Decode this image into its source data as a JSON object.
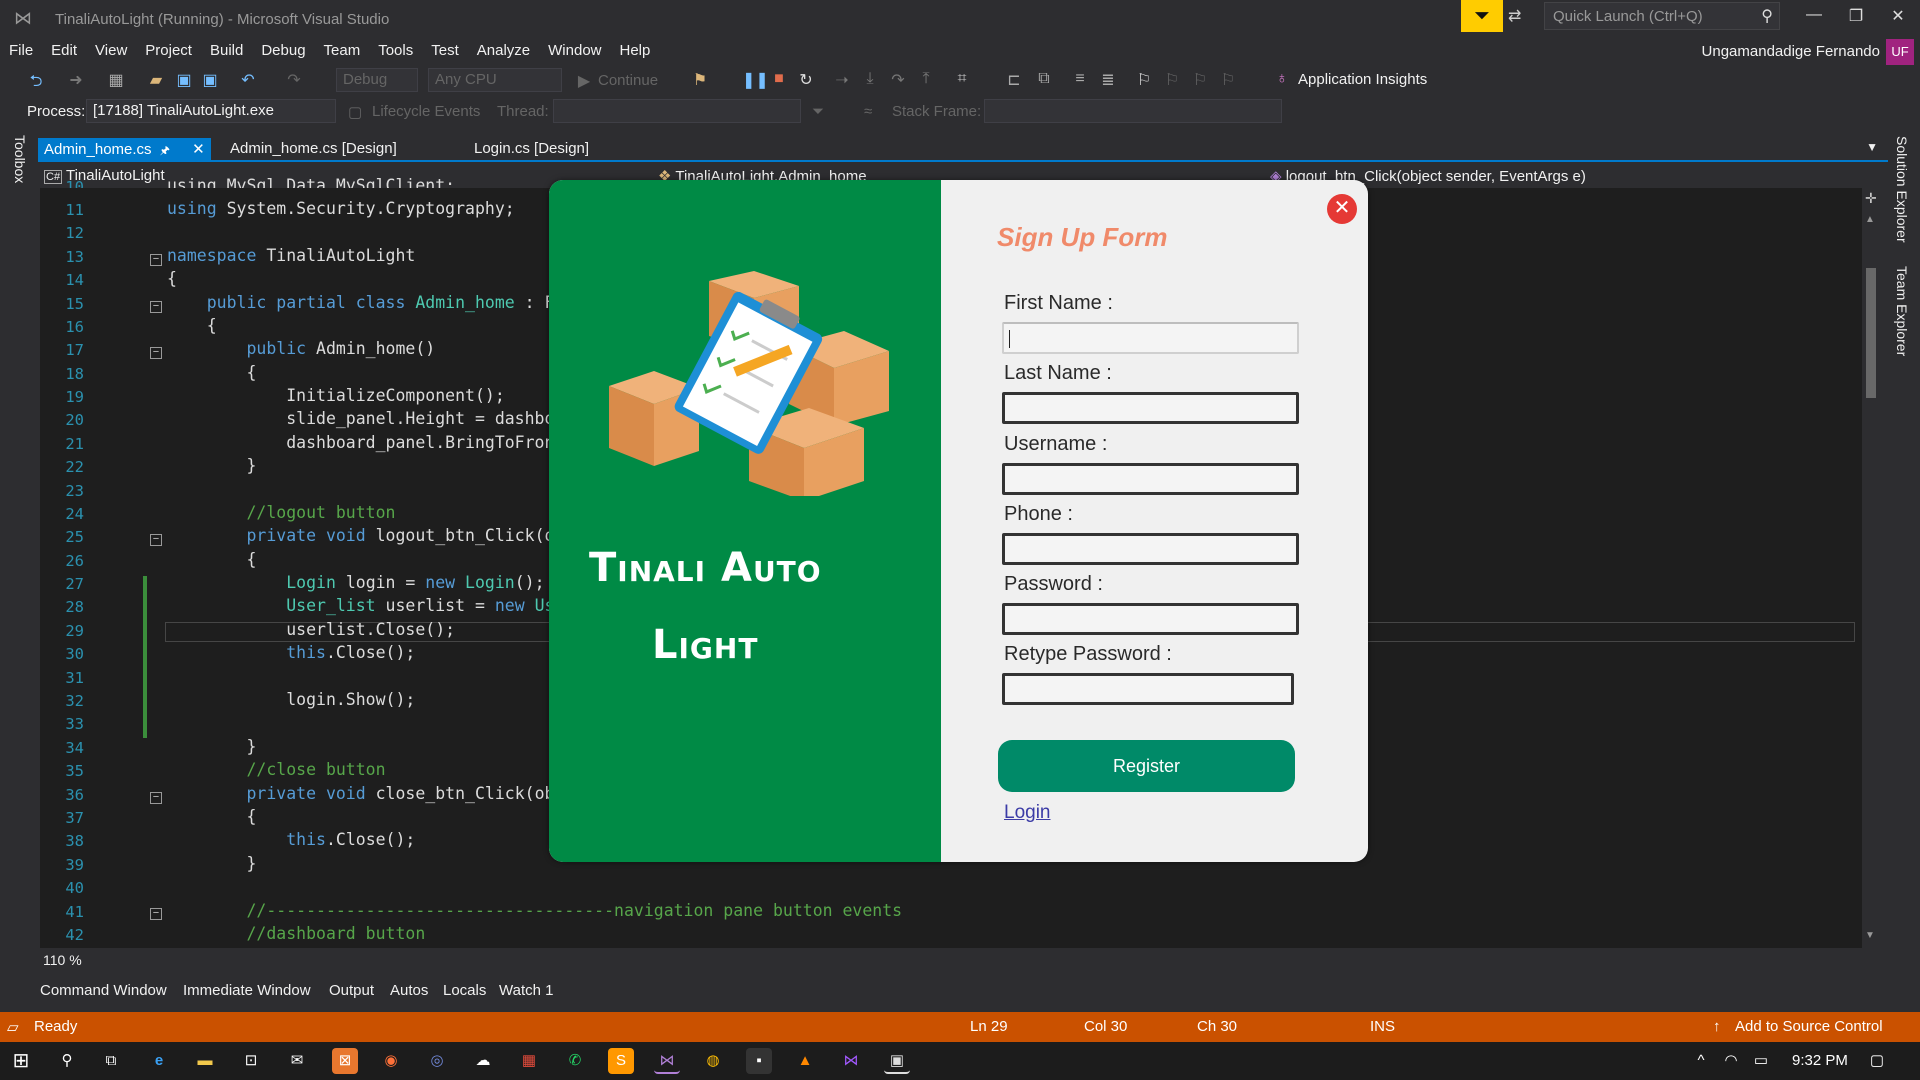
{
  "window": {
    "title": "TinaliAutoLight (Running) - Microsoft Visual Studio",
    "quick_launch_placeholder": "Quick Launch (Ctrl+Q)",
    "user": "Ungamandadige Fernando",
    "user_initials": "UF"
  },
  "menu": [
    "File",
    "Edit",
    "View",
    "Project",
    "Build",
    "Debug",
    "Team",
    "Tools",
    "Test",
    "Analyze",
    "Window",
    "Help"
  ],
  "toolbar": {
    "config": "Debug",
    "platform": "Any CPU",
    "continue_label": "Continue",
    "app_insights": "Application Insights"
  },
  "debugbar": {
    "process_label": "Process:",
    "process_value": "[17188] TinaliAutoLight.exe",
    "lifecycle": "Lifecycle Events",
    "thread_label": "Thread:",
    "stack_label": "Stack Frame:"
  },
  "toolbox_label": "Toolbox",
  "tabs": [
    {
      "label": "Admin_home.cs",
      "active": true
    },
    {
      "label": "Admin_home.cs [Design]",
      "active": false
    },
    {
      "label": "Login.cs [Design]",
      "active": false
    }
  ],
  "nav": {
    "project": "TinaliAutoLight",
    "class": "TinaliAutoLight.Admin_home",
    "member": "logout_btn_Click(object sender, EventArgs e)"
  },
  "code": {
    "line_numbers": [
      "10",
      "11",
      "12",
      "13",
      "14",
      "15",
      "16",
      "17",
      "18",
      "19",
      "20",
      "21",
      "22",
      "23",
      "24",
      "25",
      "26",
      "27",
      "28",
      "29",
      "30",
      "31",
      "32",
      "33",
      "34",
      "35",
      "36",
      "37",
      "38",
      "39",
      "40",
      "41",
      "42"
    ],
    "l10": "using MySql.Data.MySqlClient;",
    "l11_kw": "using",
    "l11_rest": " System.Security.Cryptography;",
    "l13_kw": "namespace",
    "l13_rest": " TinaliAutoLight",
    "l14": "{",
    "l15_kw": "    public partial class",
    "l15_ty": " Admin_home",
    "l15_rest": " : F",
    "l16": "    {",
    "l17_kw": "        public",
    "l17_rest": " Admin_home()",
    "l18": "        {",
    "l19": "            InitializeComponent();",
    "l20": "            slide_panel.Height = dashbo",
    "l21": "            dashboard_panel.BringToFron",
    "l22": "        }",
    "l24": "        //logout button",
    "l25_kw": "        private void",
    "l25_rest": " logout_btn_Click(o",
    "l26": "        {",
    "l27_a": "            Login",
    "l27_b": " login = ",
    "l27_c": "new",
    "l27_d": " Login",
    "l27_e": "();",
    "l28_a": "            User_list",
    "l28_b": " userlist = ",
    "l28_c": "new",
    "l28_d": " Us",
    "l29": "            userlist.Close();",
    "l30_kw": "            this",
    "l30_rest": ".Close();",
    "l32": "            login.Show();",
    "l34": "        }",
    "l35": "        //close button",
    "l36_kw": "        private void",
    "l36_rest": " close_btn_Click(ob",
    "l37": "        {",
    "l38_kw": "            this",
    "l38_rest": ".Close();",
    "l39": "        }",
    "l41": "        //-----------------------------------navigation pane button events",
    "l42": "        //dashboard button"
  },
  "zoom": "110 %",
  "right_tabs": [
    "Solution Explorer",
    "Team Explorer"
  ],
  "bottom_tabs": [
    "Command Window",
    "Immediate Window",
    "Output",
    "Autos",
    "Locals",
    "Watch 1"
  ],
  "status": {
    "ready": "Ready",
    "ln": "Ln 29",
    "col": "Col 30",
    "ch": "Ch 30",
    "ins": "INS",
    "source_control": "Add to Source Control"
  },
  "clock": "9:32 PM",
  "dialog": {
    "brand_line1": "Tinali Auto",
    "brand_line2": "Light",
    "form_title": "Sign Up Form",
    "fields": [
      {
        "label": "First Name :",
        "value": ""
      },
      {
        "label": "Last Name :",
        "value": ""
      },
      {
        "label": "Username :",
        "value": ""
      },
      {
        "label": "Phone :",
        "value": ""
      },
      {
        "label": "Password :",
        "value": ""
      },
      {
        "label": "Retype Password :",
        "value": ""
      }
    ],
    "register_label": "Register",
    "login_link": "Login"
  },
  "colors": {
    "status_bar": "#ca5100",
    "accent": "#007acc",
    "dialog_left": "#008a45",
    "register_button": "#008a68",
    "form_title": "#f08a6a",
    "close_button": "#e53935"
  }
}
